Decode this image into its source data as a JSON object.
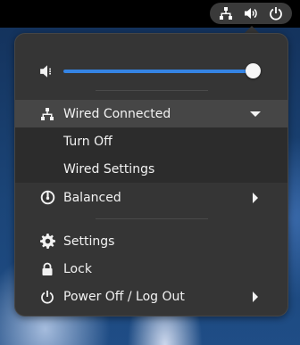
{
  "system_tray": {
    "icons": [
      "network-wired-icon",
      "volume-icon",
      "power-icon"
    ]
  },
  "menu": {
    "volume": {
      "icon": "volume-low-icon",
      "level": 0.98
    },
    "network": {
      "icon": "network-wired-icon",
      "label": "Wired Connected",
      "expanded": true,
      "submenu": [
        {
          "label": "Turn Off"
        },
        {
          "label": "Wired Settings"
        }
      ]
    },
    "power_mode": {
      "icon": "power-profile-icon",
      "label": "Balanced"
    },
    "settings": {
      "icon": "gear-icon",
      "label": "Settings"
    },
    "lock": {
      "icon": "lock-icon",
      "label": "Lock"
    },
    "power_off": {
      "icon": "power-icon",
      "label": "Power Off / Log Out"
    }
  },
  "colors": {
    "accent": "#3584e4",
    "menu_bg": "#353535",
    "submenu_bg": "#2c2c2c",
    "highlight": "#464646"
  }
}
